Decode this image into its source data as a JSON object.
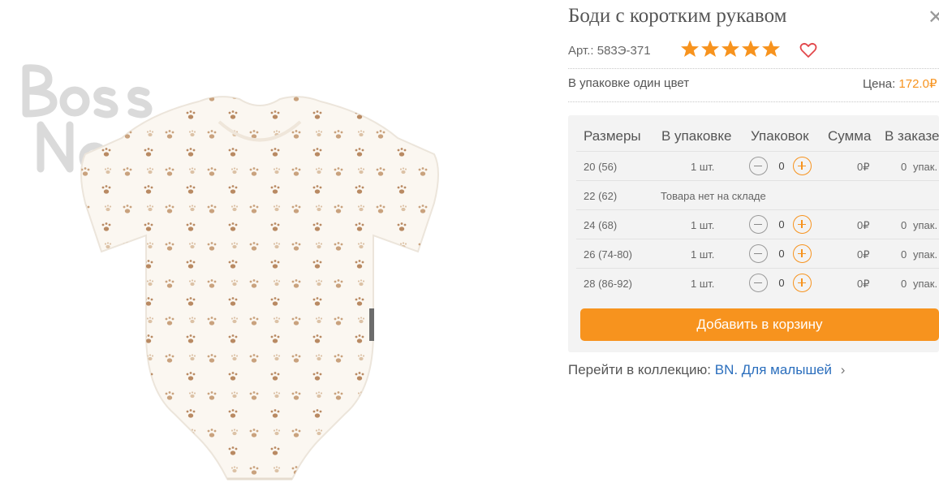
{
  "product": {
    "title": "Боди с коротким рукавом",
    "article": "Арт.: 583Э-371",
    "rating": 5,
    "rating_max": 5,
    "color_note": "В упаковке один цвет",
    "price_label": "Цена:",
    "price_value": "172.0₽"
  },
  "table": {
    "headers": [
      "Размеры",
      "В упаковке",
      "Упаковок",
      "Сумма",
      "В заказе"
    ],
    "rows": [
      {
        "size": "20 (56)",
        "pack": "1 шт.",
        "qty": "0",
        "sum": "0₽",
        "order": "0",
        "order_unit": "упак.",
        "available": true
      },
      {
        "size": "22 (62)",
        "out_of_stock": "Товара нет на складе",
        "available": false
      },
      {
        "size": "24 (68)",
        "pack": "1 шт.",
        "qty": "0",
        "sum": "0₽",
        "order": "0",
        "order_unit": "упак.",
        "available": true
      },
      {
        "size": "26 (74-80)",
        "pack": "1 шт.",
        "qty": "0",
        "sum": "0₽",
        "order": "0",
        "order_unit": "упак.",
        "available": true
      },
      {
        "size": "28 (86-92)",
        "pack": "1 шт.",
        "qty": "0",
        "sum": "0₽",
        "order": "0",
        "order_unit": "упак.",
        "available": true
      }
    ]
  },
  "cart_button": "Добавить в корзину",
  "collection": {
    "label": "Перейти в коллекцию:",
    "link": "BN. Для малышей"
  },
  "watermark": "Bossa Nova",
  "colors": {
    "accent": "#f7931e",
    "link": "#2a6ebd",
    "heart": "#e2474b"
  },
  "icons": {
    "close": "close-icon",
    "star": "star-icon",
    "heart": "heart-icon",
    "minus": "minus-icon",
    "plus": "plus-icon",
    "chevron": "chevron-right-icon"
  }
}
